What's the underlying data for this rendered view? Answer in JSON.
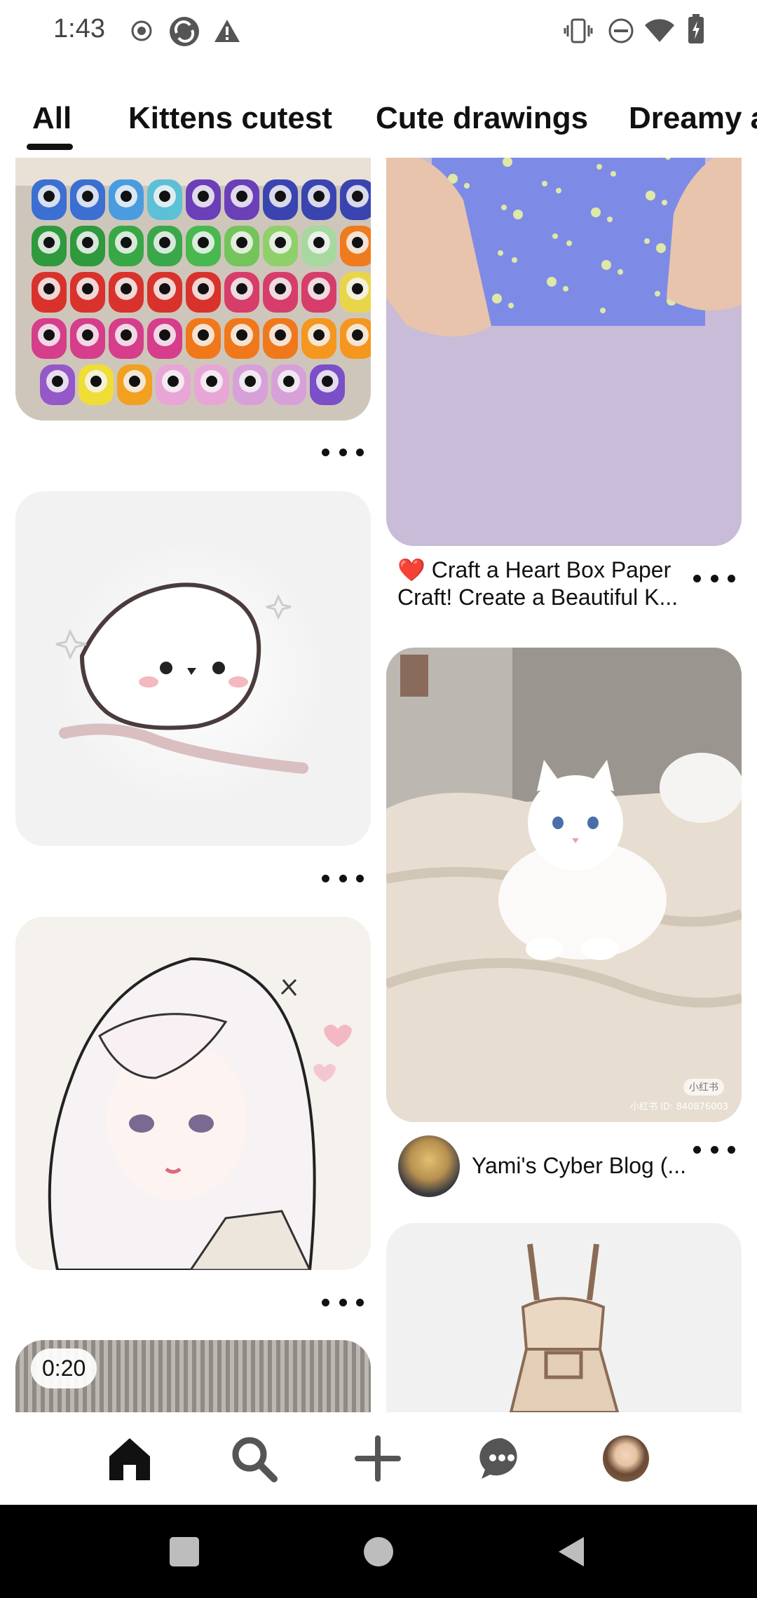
{
  "status": {
    "time": "1:43"
  },
  "tabs": [
    {
      "label": "All"
    },
    {
      "label": "Kittens cutest"
    },
    {
      "label": "Cute drawings"
    },
    {
      "label": "Dreamy a"
    }
  ],
  "feed": {
    "pins": [
      {
        "alt": "craft punches"
      },
      {
        "title": "❤️ Craft a Heart Box Paper Craft! Create a Beautiful K..."
      },
      {
        "alt": "chick drawing"
      },
      {
        "board": "Yami's Cyber Blog (...",
        "watermark": "小红书 ID: 840876003",
        "watermark_logo": "小红书"
      },
      {
        "alt": "anime girl"
      },
      {
        "alt": "dress sketch"
      },
      {
        "video_duration": "0:20"
      }
    ]
  },
  "nav": {
    "items": [
      {
        "icon": "home-icon"
      },
      {
        "icon": "search-icon"
      },
      {
        "icon": "plus-icon"
      },
      {
        "icon": "chat-icon"
      },
      {
        "icon": "profile-icon"
      }
    ]
  },
  "colors": {
    "accent": "#111111",
    "card_bg": "#f2f2f2",
    "pin_blue": "#7e8be6"
  }
}
